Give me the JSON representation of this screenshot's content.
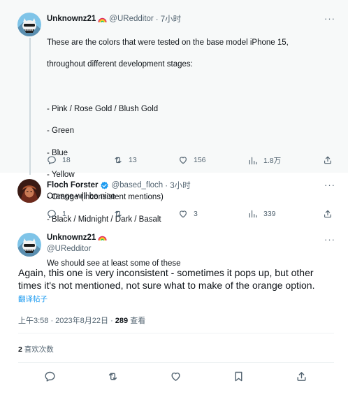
{
  "tweet1": {
    "name": "Unknownz21",
    "handle": "@URedditor",
    "time": "· 7小时",
    "lines": [
      "These are the colors that were tested on the base model iPhone 15,",
      "throughout different development stages:",
      "",
      "- Pink / Rose Gold / Blush Gold",
      "- Green",
      "- Blue",
      "- Yellow",
      "- Orange (inconsistent mentions)",
      "- Black / Midnight / Dark / Basalt",
      "",
      "We should see at least some of these"
    ],
    "replies": "18",
    "retweets": "13",
    "likes": "156",
    "views": "1.8万"
  },
  "tweet2": {
    "name": "Floch Forster",
    "handle": "@based_floch",
    "time": "· 3小时",
    "text": "Orange will be nice",
    "replies": "1",
    "retweets": "",
    "likes": "3",
    "views": "339"
  },
  "main": {
    "name": "Unknownz21",
    "handle": "@URedditor",
    "text": "Again, this one is very inconsistent - sometimes it pops up, but other times it's not mentioned, not sure what to make of the orange option.",
    "translate": "翻译帖子",
    "timestamp": "上午3:58 · 2023年8月22日 · ",
    "view_count": "289",
    "view_label": " 查看",
    "likes_count": "2",
    "likes_label": " 喜欢次数"
  },
  "colors": {
    "verified": "#1d9bf0",
    "secondary_text": "#536471",
    "link": "#1d9bf0",
    "thread_bg": "#f7f9f9"
  },
  "icons": [
    "more-icon",
    "rainbow-icon",
    "verified-icon",
    "reply-icon",
    "retweet-icon",
    "like-icon",
    "views-icon",
    "share-icon",
    "bookmark-icon"
  ]
}
